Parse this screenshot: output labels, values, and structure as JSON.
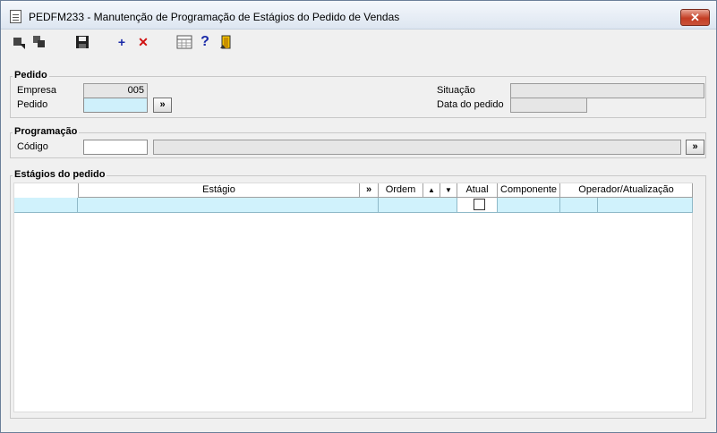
{
  "window": {
    "title": "PEDFM233 - Manutenção de Programação de Estágios do Pedido de Vendas",
    "close_label": "✕"
  },
  "toolbar": {
    "icons": [
      "first-record-icon",
      "last-record-icon",
      "save-icon",
      "add-icon",
      "delete-icon",
      "calendar-grid-icon",
      "help-icon",
      "exit-door-icon"
    ],
    "add_label": "+",
    "delete_label": "✕",
    "help_label": "?"
  },
  "pedido": {
    "title": "Pedido",
    "empresa_label": "Empresa",
    "empresa_value": "005",
    "pedido_label": "Pedido",
    "pedido_value": "",
    "lookup_label": "»",
    "situacao_label": "Situação",
    "situacao_value": "",
    "data_label": "Data do pedido",
    "data_value": ""
  },
  "programacao": {
    "title": "Programação",
    "codigo_label": "Código",
    "codigo_value": "",
    "descricao_value": "",
    "lookup_label": "»"
  },
  "estagios": {
    "title": "Estágios do pedido",
    "columns": {
      "estagio": "Estágio",
      "lookup": "»",
      "ordem": "Ordem",
      "up": "▲",
      "down": "▼",
      "atual": "Atual",
      "componente": "Componente",
      "operador": "Operador/Atualização"
    }
  },
  "colors": {
    "highlight": "#cff0fb",
    "readonly": "#e6e6e6",
    "close": "#c43d24"
  }
}
